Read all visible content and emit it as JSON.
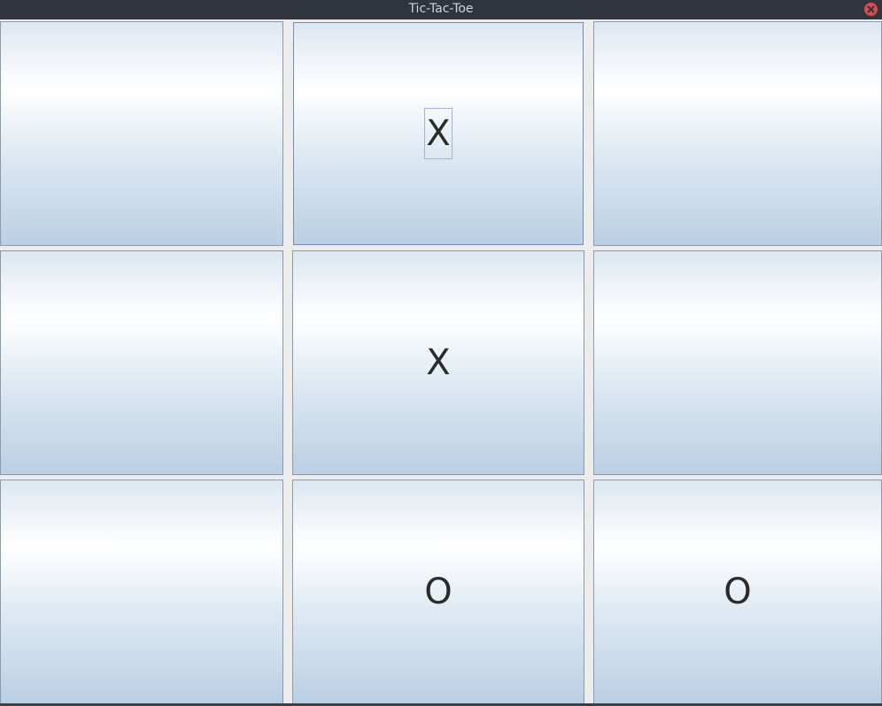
{
  "window": {
    "title": "Tic-Tac-Toe"
  },
  "board": {
    "cells": [
      {
        "row": 0,
        "col": 0,
        "mark": ""
      },
      {
        "row": 0,
        "col": 1,
        "mark": "X"
      },
      {
        "row": 0,
        "col": 2,
        "mark": ""
      },
      {
        "row": 1,
        "col": 0,
        "mark": ""
      },
      {
        "row": 1,
        "col": 1,
        "mark": "X"
      },
      {
        "row": 1,
        "col": 2,
        "mark": ""
      },
      {
        "row": 2,
        "col": 0,
        "mark": ""
      },
      {
        "row": 2,
        "col": 1,
        "mark": "O"
      },
      {
        "row": 2,
        "col": 2,
        "mark": "O"
      }
    ],
    "focused_cell": 1
  },
  "colors": {
    "titlebar": "#2f343f",
    "close_button": "#e04b4f",
    "cell_gradient_top": "#ffffff",
    "cell_gradient_bottom": "#b9cfe4",
    "mark": "#2b2b2b"
  }
}
